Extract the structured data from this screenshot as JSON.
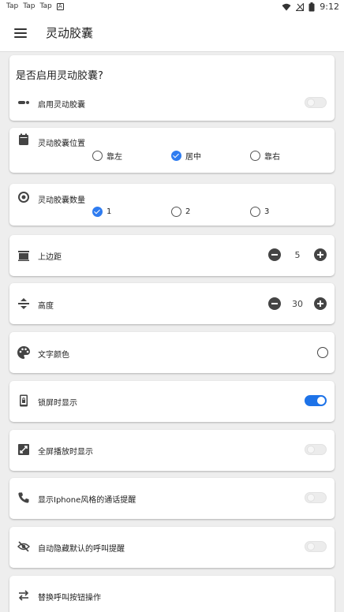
{
  "status_bar": {
    "left_items": [
      "Tap",
      "Tap",
      "Tap",
      "A"
    ],
    "time": "9:12"
  },
  "app_bar": {
    "title": "灵动胶囊"
  },
  "enable_card": {
    "question": "是否启用灵动胶囊?",
    "label": "启用灵动胶囊",
    "switch_on": false
  },
  "position_card": {
    "label": "灵动胶囊位置",
    "options": [
      {
        "label": "靠左",
        "checked": false
      },
      {
        "label": "居中",
        "checked": true
      },
      {
        "label": "靠右",
        "checked": false
      }
    ]
  },
  "count_card": {
    "label": "灵动胶囊数量",
    "options": [
      {
        "label": "1",
        "checked": true
      },
      {
        "label": "2",
        "checked": false
      },
      {
        "label": "3",
        "checked": false
      }
    ]
  },
  "top_margin": {
    "label": "上边距",
    "value": "5"
  },
  "height": {
    "label": "高度",
    "value": "30"
  },
  "text_color": {
    "label": "文字颜色"
  },
  "lock_screen": {
    "label": "锁屏时显示",
    "switch_on": true
  },
  "fullscreen": {
    "label": "全屏播放时显示",
    "switch_on": false
  },
  "iphone_call": {
    "label": "显示Iphone风格的通话提醒",
    "switch_on": false
  },
  "auto_hide": {
    "label": "自动隐藏默认的呼叫提醒",
    "switch_on": false
  },
  "swap_buttons": {
    "label": "替换呼叫按钮操作"
  },
  "colors": {
    "accent": "#1e73e8",
    "background": "#eeeeee",
    "card": "#ffffff"
  }
}
